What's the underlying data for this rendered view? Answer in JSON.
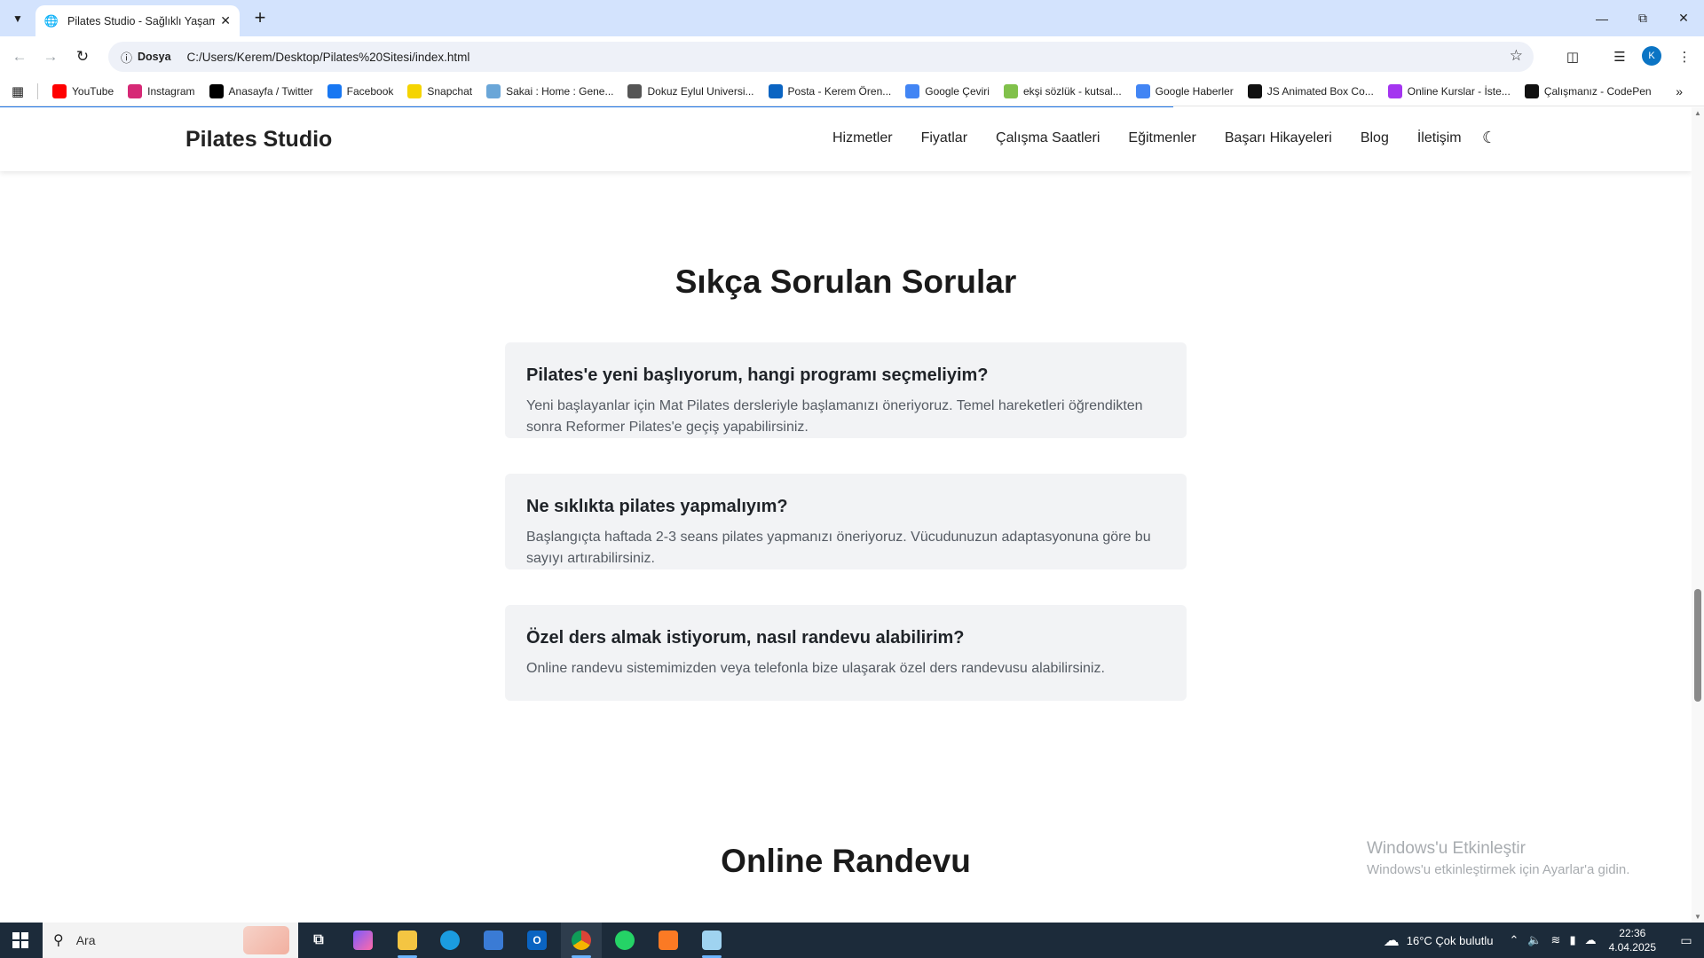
{
  "browser": {
    "tab_title": "Pilates Studio - Sağlıklı Yaşamın",
    "site_chip": "Dosya",
    "url": "C:/Users/Kerem/Desktop/Pilates%20Sitesi/index.html",
    "profile_initial": "K",
    "bookmarks": [
      {
        "label": "YouTube",
        "icon": "youtube-icon",
        "color": "#ff0000"
      },
      {
        "label": "Instagram",
        "icon": "instagram-icon",
        "color": "#d62976"
      },
      {
        "label": "Anasayfa / Twitter",
        "icon": "x-icon",
        "color": "#000000"
      },
      {
        "label": "Facebook",
        "icon": "facebook-icon",
        "color": "#1877f2"
      },
      {
        "label": "Snapchat",
        "icon": "snapchat-icon",
        "color": "#f5d400"
      },
      {
        "label": "Sakai : Home : Gene...",
        "icon": "sakai-icon",
        "color": "#6aa6d8"
      },
      {
        "label": "Dokuz Eylul Universi...",
        "icon": "globe-icon",
        "color": "#555555"
      },
      {
        "label": "Posta - Kerem Ören...",
        "icon": "outlook-icon",
        "color": "#0a64c2"
      },
      {
        "label": "Google Çeviri",
        "icon": "translate-icon",
        "color": "#4285f4"
      },
      {
        "label": "ekşi sözlük - kutsal...",
        "icon": "eksi-icon",
        "color": "#81c14b"
      },
      {
        "label": "Google Haberler",
        "icon": "news-icon",
        "color": "#4285f4"
      },
      {
        "label": "JS Animated Box Co...",
        "icon": "codepen-icon",
        "color": "#111111"
      },
      {
        "label": "Online Kurslar - İste...",
        "icon": "udemy-icon",
        "color": "#a435f0"
      },
      {
        "label": "Çalışmanız - CodePen",
        "icon": "codepen-icon",
        "color": "#111111"
      }
    ]
  },
  "site": {
    "logo": "Pilates Studio",
    "nav": [
      "Hizmetler",
      "Fiyatlar",
      "Çalışma Saatleri",
      "Eğitmenler",
      "Başarı Hikayeleri",
      "Blog",
      "İletişim"
    ]
  },
  "faq": {
    "title": "Sıkça Sorulan Sorular",
    "items": [
      {
        "q": "Pilates'e yeni başlıyorum, hangi programı seçmeliyim?",
        "a": "Yeni başlayanlar için Mat Pilates dersleriyle başlamanızı öneriyoruz. Temel hareketleri öğrendikten sonra Reformer Pilates'e geçiş yapabilirsiniz."
      },
      {
        "q": "Ne sıklıkta pilates yapmalıyım?",
        "a": "Başlangıçta haftada 2-3 seans pilates yapmanızı öneriyoruz. Vücudunuzun adaptasyonuna göre bu sayıyı artırabilirsiniz."
      },
      {
        "q": "Özel ders almak istiyorum, nasıl randevu alabilirim?",
        "a": "Online randevu sistemimizden veya telefonla bize ulaşarak özel ders randevusu alabilirsiniz."
      }
    ]
  },
  "online_title": "Online Randevu",
  "watermark": {
    "line1": "Windows'u Etkinleştir",
    "line2": "Windows'u etkinleştirmek için Ayarlar'a gidin."
  },
  "taskbar": {
    "search_placeholder": "Ara",
    "weather": "16°C  Çok bulutlu",
    "time": "22:36",
    "date": "4.04.2025"
  }
}
